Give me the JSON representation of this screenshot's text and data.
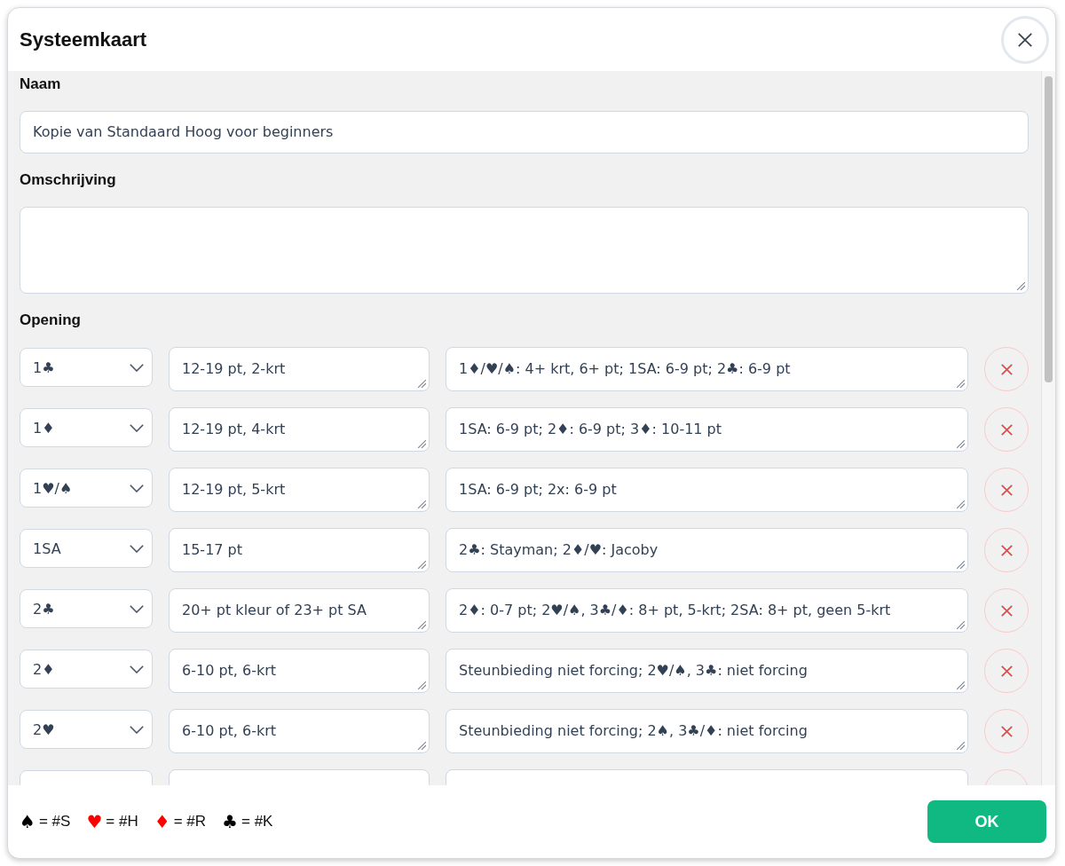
{
  "dialog": {
    "title": "Systeemkaart"
  },
  "name": {
    "label": "Naam",
    "value": "Kopie van Standaard Hoog voor beginners"
  },
  "description": {
    "label": "Omschrijving"
  },
  "opening": {
    "label": "Opening",
    "rows": [
      {
        "bid": "1♣",
        "meaning": "12-19 pt, 2-krt",
        "responses": "1♦/♥/♠: 4+ krt, 6+ pt; 1SA: 6-9 pt; 2♣: 6-9 pt"
      },
      {
        "bid": "1♦",
        "meaning": "12-19 pt, 4-krt",
        "responses": "1SA: 6-9 pt; 2♦: 6-9 pt; 3♦: 10-11 pt"
      },
      {
        "bid": "1♥/♠",
        "meaning": "12-19 pt, 5-krt",
        "responses": "1SA: 6-9 pt; 2x: 6-9 pt"
      },
      {
        "bid": "1SA",
        "meaning": "15-17 pt",
        "responses": "2♣: Stayman; 2♦/♥: Jacoby"
      },
      {
        "bid": "2♣",
        "meaning": "20+ pt kleur of 23+ pt SA",
        "responses": "2♦: 0-7 pt; 2♥/♠, 3♣/♦: 8+ pt, 5-krt; 2SA: 8+ pt, geen 5-krt"
      },
      {
        "bid": "2♦",
        "meaning": "6-10 pt, 6-krt",
        "responses": "Steunbieding niet forcing; 2♥/♠, 3♣: niet forcing"
      },
      {
        "bid": "2♥",
        "meaning": "6-10 pt, 6-krt",
        "responses": "Steunbieding niet forcing; 2♠, 3♣/♦: niet forcing"
      },
      {}
    ]
  },
  "legend": [
    {
      "symbol": "♠",
      "color": "#000000",
      "text": "= #S"
    },
    {
      "symbol": "♥",
      "color": "#ff0000",
      "text": "= #H"
    },
    {
      "symbol": "♦",
      "color": "#ff0000",
      "text": "= #R"
    },
    {
      "symbol": "♣",
      "color": "#000000",
      "text": "= #K"
    }
  ],
  "ok_button": {
    "label": "OK"
  }
}
